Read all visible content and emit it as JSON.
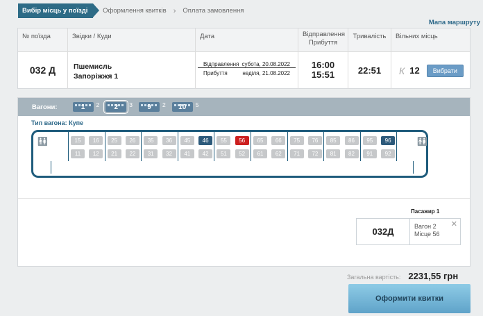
{
  "steps": [
    "Вибір місць у поїзді",
    "Оформлення квитків",
    "Оплата замовлення"
  ],
  "route_link": "Мапа маршруту",
  "table": {
    "headers": [
      "№ поїзда",
      "Звідки / Куди",
      "Дата",
      "Відправлення\nПрибуття",
      "Тривалість",
      "Вільних місць"
    ],
    "train_no": "032 Д",
    "from": "Пшемисль",
    "to": "Запоріжжя 1",
    "dep_label": "Відправлення",
    "dep_date": "субота, 20.08.2022",
    "arr_label": "Прибуття",
    "arr_date": "неділя, 21.08.2022",
    "dep_time": "16:00",
    "arr_time": "15:51",
    "duration": "22:51",
    "class": "К",
    "free_seats": "12",
    "choose_label": "Вибрати"
  },
  "wagons": {
    "label": "Вагони:",
    "items": [
      {
        "number": "1",
        "free": "2",
        "selected": false
      },
      {
        "number": "2",
        "free": "3",
        "selected": true
      },
      {
        "number": "9",
        "free": "2",
        "selected": false
      },
      {
        "number": "10",
        "free": "5",
        "selected": false
      }
    ],
    "type_label": "Тип вагона: Купе"
  },
  "seats": {
    "top": [
      "15",
      "16",
      "25",
      "26",
      "35",
      "36",
      "45",
      "46",
      "55",
      "56",
      "65",
      "66",
      "75",
      "76",
      "85",
      "86",
      "95",
      "96"
    ],
    "bottom": [
      "11",
      "12",
      "21",
      "22",
      "31",
      "32",
      "41",
      "42",
      "51",
      "52",
      "61",
      "62",
      "71",
      "72",
      "81",
      "82",
      "91",
      "92"
    ],
    "free": [
      "46",
      "96"
    ],
    "selected": [
      "56"
    ]
  },
  "passenger": {
    "label": "Пасажир 1",
    "train": "032Д",
    "wagon": "Вагон 2",
    "seat": "Місце 56"
  },
  "total": {
    "label": "Загальна вартість:",
    "value": "2231,55 грн"
  },
  "checkout_label": "Оформити квитки",
  "colors": {
    "primary": "#2d6b86",
    "free_seat": "#2d5a7b",
    "selected_seat": "#cc1f1f",
    "occupied_seat": "#c6c8ca"
  }
}
